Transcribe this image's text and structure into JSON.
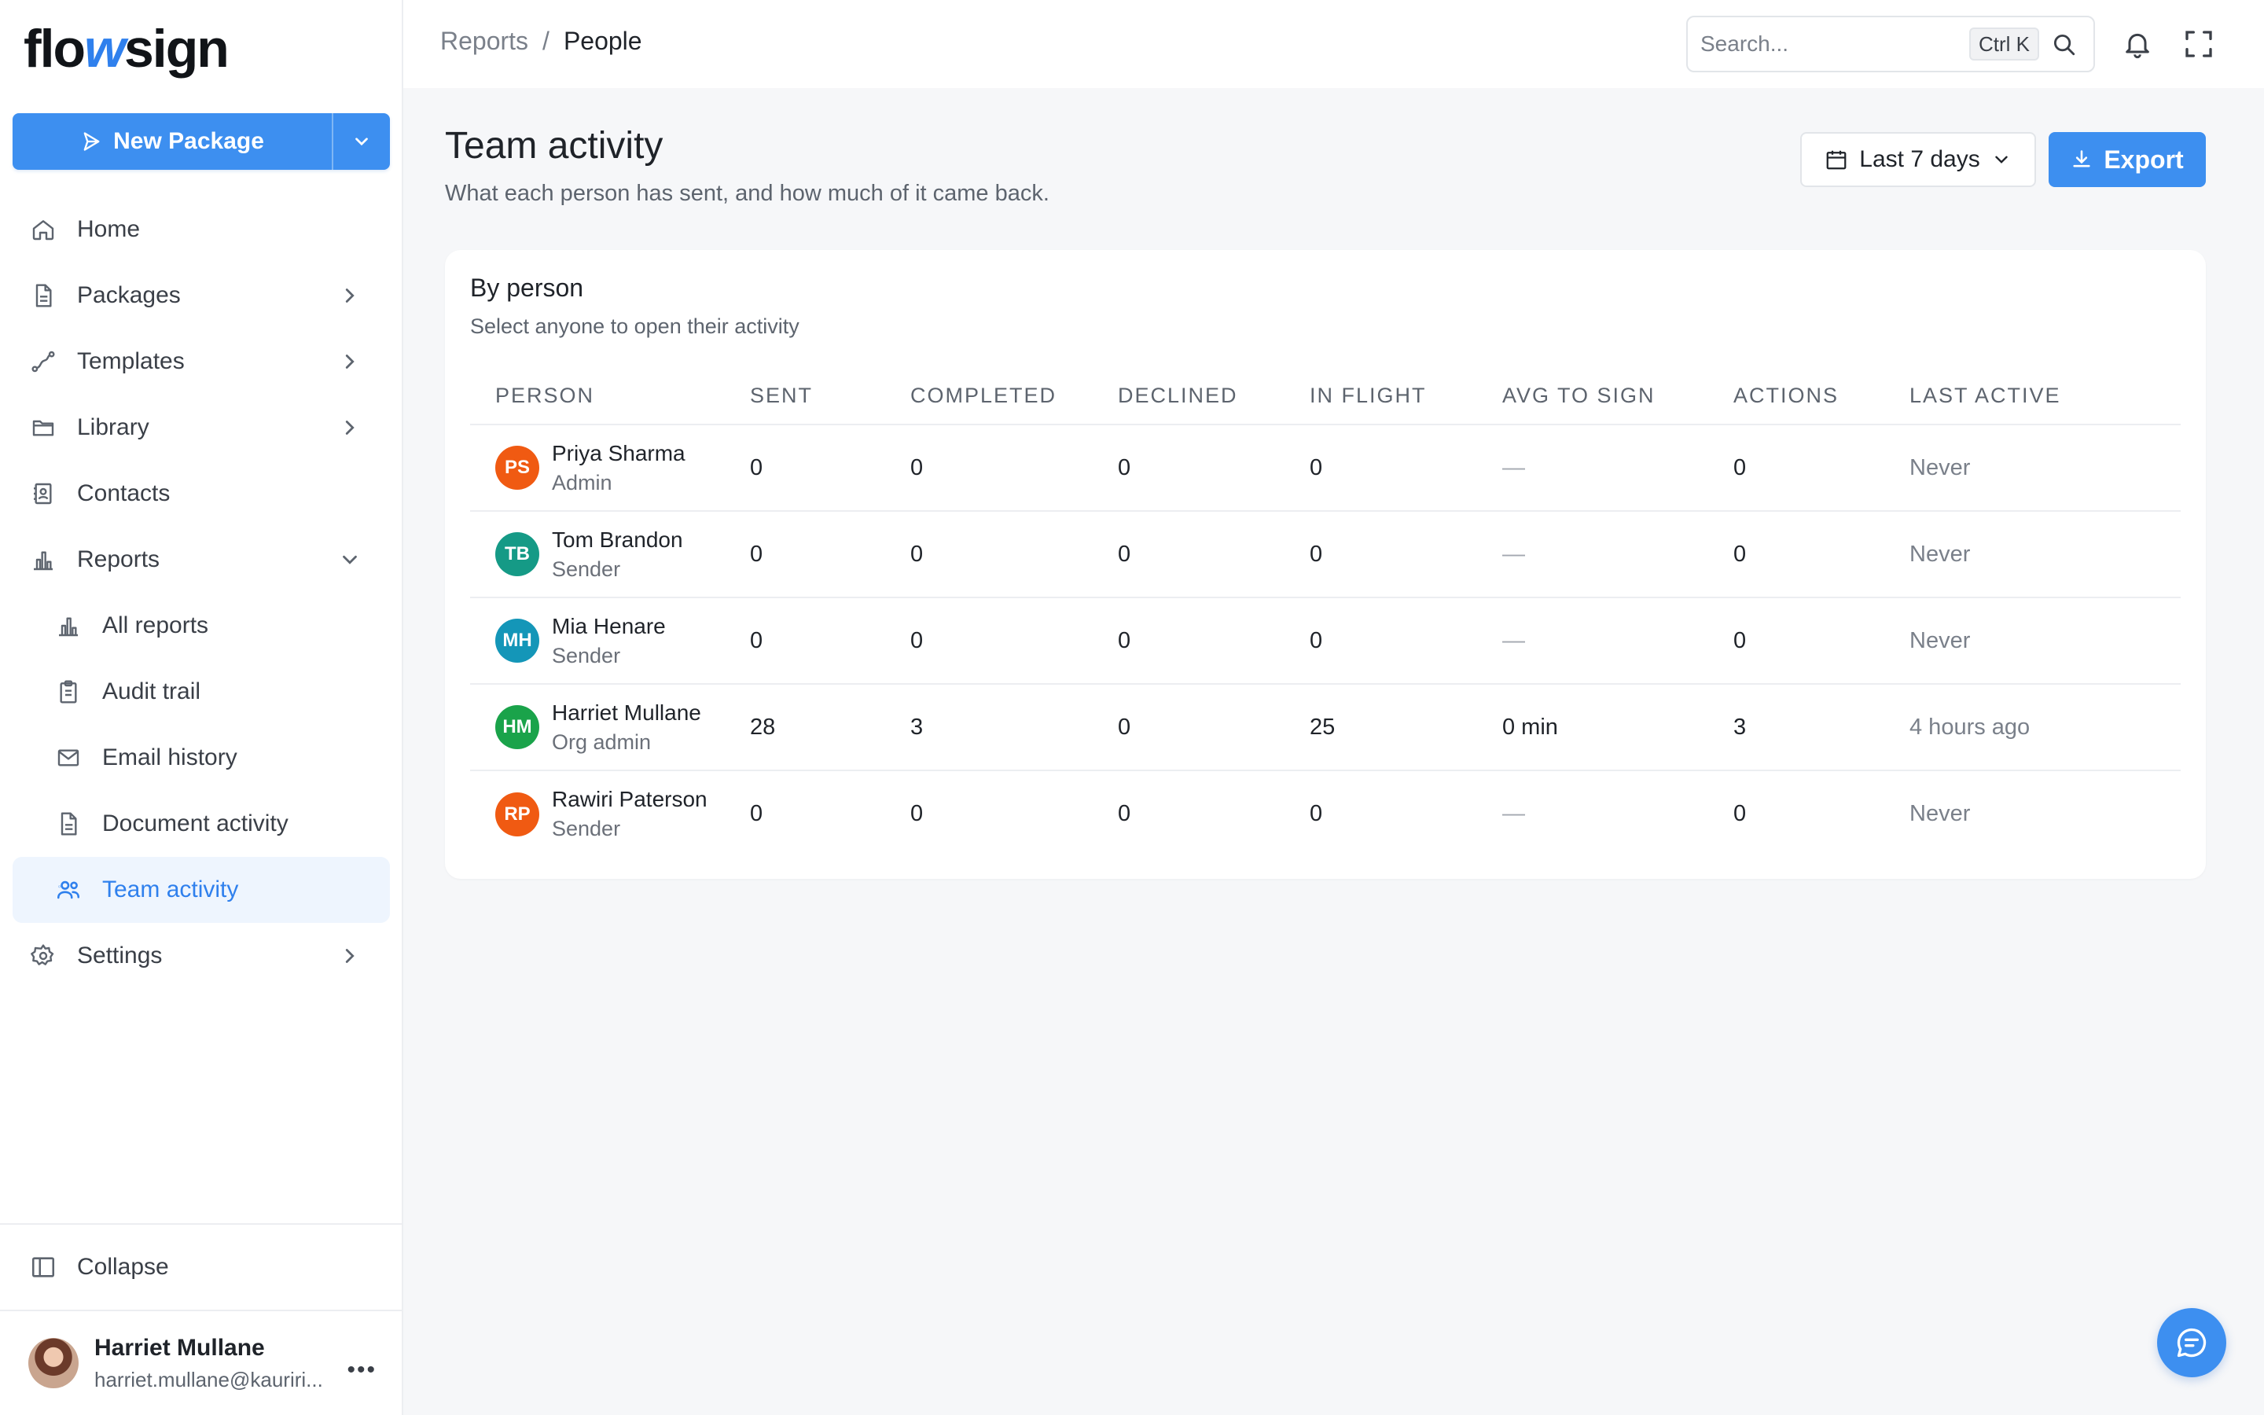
{
  "brand": {
    "part1": "flo",
    "part2": "w",
    "part3": "sign"
  },
  "sidebar": {
    "new_package": "New Package",
    "items": [
      {
        "label": "Home"
      },
      {
        "label": "Packages"
      },
      {
        "label": "Templates"
      },
      {
        "label": "Library"
      },
      {
        "label": "Contacts"
      },
      {
        "label": "Reports"
      },
      {
        "label": "All reports"
      },
      {
        "label": "Audit trail"
      },
      {
        "label": "Email history"
      },
      {
        "label": "Document activity"
      },
      {
        "label": "Team activity"
      },
      {
        "label": "Settings"
      }
    ],
    "collapse": "Collapse",
    "user": {
      "name": "Harriet Mullane",
      "email": "harriet.mullane@kauriri..."
    }
  },
  "header": {
    "breadcrumb_parent": "Reports",
    "breadcrumb_sep": "/",
    "breadcrumb_current": "People",
    "search_placeholder": "Search...",
    "search_shortcut": "Ctrl K"
  },
  "main": {
    "title": "Team activity",
    "subtitle": "What each person has sent, and how much of it came back.",
    "range_label": "Last 7 days",
    "export_label": "Export",
    "card": {
      "title": "By person",
      "subtitle": "Select anyone to open their activity",
      "columns": [
        "PERSON",
        "SENT",
        "COMPLETED",
        "DECLINED",
        "IN FLIGHT",
        "AVG TO SIGN",
        "ACTIONS",
        "LAST ACTIVE"
      ],
      "rows": [
        {
          "initials": "PS",
          "color": "#f05a12",
          "name": "Priya Sharma",
          "role": "Admin",
          "sent": "0",
          "completed": "0",
          "declined": "0",
          "in_flight": "0",
          "avg": "—",
          "actions": "0",
          "last": "Never"
        },
        {
          "initials": "TB",
          "color": "#159a86",
          "name": "Tom Brandon",
          "role": "Sender",
          "sent": "0",
          "completed": "0",
          "declined": "0",
          "in_flight": "0",
          "avg": "—",
          "actions": "0",
          "last": "Never"
        },
        {
          "initials": "MH",
          "color": "#1496b8",
          "name": "Mia Henare",
          "role": "Sender",
          "sent": "0",
          "completed": "0",
          "declined": "0",
          "in_flight": "0",
          "avg": "—",
          "actions": "0",
          "last": "Never"
        },
        {
          "initials": "HM",
          "color": "#1aa34a",
          "name": "Harriet Mullane",
          "role": "Org admin",
          "sent": "28",
          "completed": "3",
          "declined": "0",
          "in_flight": "25",
          "avg": "0 min",
          "actions": "3",
          "last": "4 hours ago"
        },
        {
          "initials": "RP",
          "color": "#f05a12",
          "name": "Rawiri Paterson",
          "role": "Sender",
          "sent": "0",
          "completed": "0",
          "declined": "0",
          "in_flight": "0",
          "avg": "—",
          "actions": "0",
          "last": "Never"
        }
      ]
    }
  },
  "colors": {
    "accent": "#3d8ff0"
  }
}
